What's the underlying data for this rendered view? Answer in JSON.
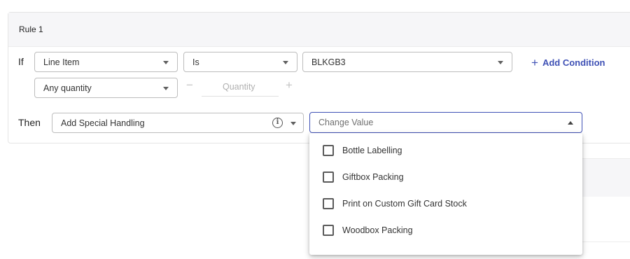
{
  "rule": {
    "title": "Rule 1",
    "if_label": "If",
    "then_label": "Then"
  },
  "conditions": {
    "field": {
      "value": "Line Item"
    },
    "operator": {
      "value": "Is"
    },
    "target": {
      "value": "BLKGB3"
    },
    "quantity_mode": {
      "value": "Any quantity"
    },
    "quantity_stepper": {
      "placeholder": "Quantity",
      "minus": "−",
      "plus": "+"
    },
    "add_condition_label": "Add Condition",
    "add_condition_icon": "+"
  },
  "action": {
    "type": {
      "value": "Add Special Handling",
      "info_icon": "i"
    },
    "value": {
      "placeholder": "Change Value"
    }
  },
  "dropdown": {
    "options": [
      {
        "label": "Bottle Labelling",
        "checked": false
      },
      {
        "label": "Giftbox Packing",
        "checked": false
      },
      {
        "label": "Print on Custom Gift Card Stock",
        "checked": false
      },
      {
        "label": "Woodbox Packing",
        "checked": false
      }
    ]
  },
  "colors": {
    "accent": "#3f51b5",
    "header_bg": "#f6f6f8",
    "border": "#bdbdbd"
  }
}
